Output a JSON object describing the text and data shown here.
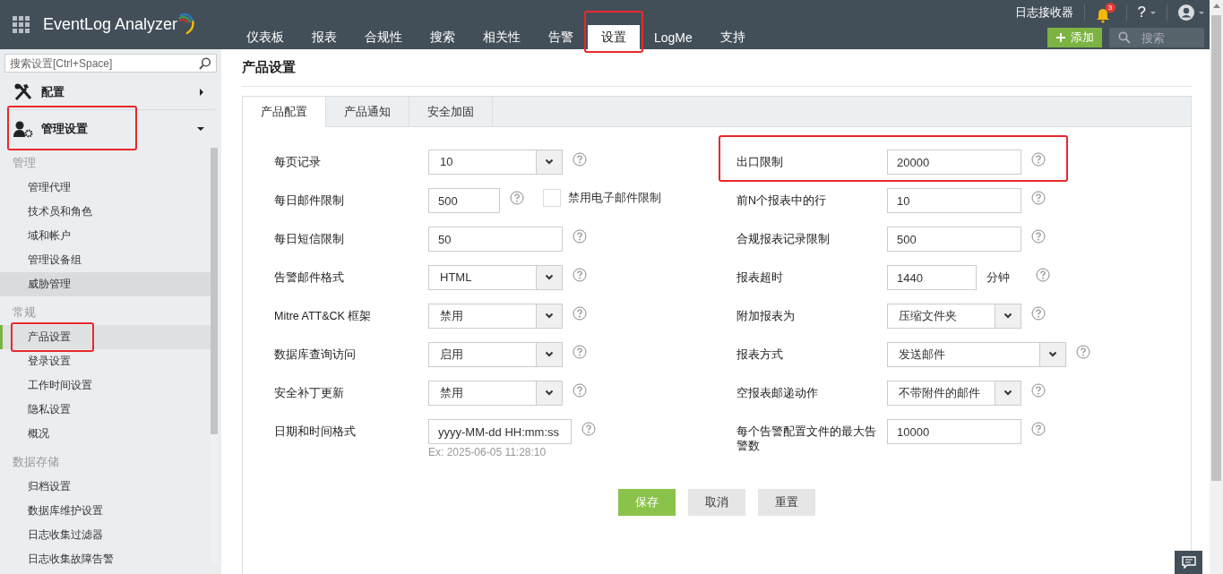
{
  "header": {
    "app_name": "EventLog Analyzer",
    "nav": [
      {
        "label": "仪表板",
        "selected": false,
        "highlighted": false
      },
      {
        "label": "报表",
        "selected": false,
        "highlighted": false
      },
      {
        "label": "合规性",
        "selected": false,
        "highlighted": false
      },
      {
        "label": "搜索",
        "selected": false,
        "highlighted": false
      },
      {
        "label": "相关性",
        "selected": false,
        "highlighted": false
      },
      {
        "label": "告警",
        "selected": false,
        "highlighted": false
      },
      {
        "label": "设置",
        "selected": true,
        "highlighted": true
      },
      {
        "label": "LogMe",
        "selected": false,
        "highlighted": false
      },
      {
        "label": "支持",
        "selected": false,
        "highlighted": false
      }
    ],
    "receiver_link": "日志接收器",
    "notification_count": "3",
    "help": "?",
    "add_button": "添加",
    "search": {
      "placeholder": "搜索"
    }
  },
  "sidebar": {
    "search": {
      "placeholder": "搜索设置[Ctrl+Space]"
    },
    "sections": [
      {
        "label": "配置",
        "expanded": false,
        "highlighted": false
      },
      {
        "label": "管理设置",
        "expanded": true,
        "highlighted": true
      }
    ],
    "groups": [
      {
        "title": "管理",
        "items": [
          {
            "label": "管理代理",
            "selected": false,
            "hovered": false,
            "highlighted": false
          },
          {
            "label": "技术员和角色",
            "selected": false,
            "hovered": false,
            "highlighted": false
          },
          {
            "label": "域和帐户",
            "selected": false,
            "hovered": false,
            "highlighted": false
          },
          {
            "label": "管理设备组",
            "selected": false,
            "hovered": false,
            "highlighted": false
          },
          {
            "label": "威胁管理",
            "selected": false,
            "hovered": true,
            "highlighted": false
          }
        ]
      },
      {
        "title": "常规",
        "items": [
          {
            "label": "产品设置",
            "selected": true,
            "hovered": false,
            "highlighted": true
          },
          {
            "label": "登录设置",
            "selected": false,
            "hovered": false,
            "highlighted": false
          },
          {
            "label": "工作时间设置",
            "selected": false,
            "hovered": false,
            "highlighted": false
          },
          {
            "label": "隐私设置",
            "selected": false,
            "hovered": false,
            "highlighted": false
          },
          {
            "label": "概况",
            "selected": false,
            "hovered": false,
            "highlighted": false
          }
        ]
      },
      {
        "title": "数据存储",
        "items": [
          {
            "label": "归档设置",
            "selected": false,
            "hovered": false,
            "highlighted": false
          },
          {
            "label": "数据库维护设置",
            "selected": false,
            "hovered": false,
            "highlighted": false
          },
          {
            "label": "日志收集过滤器",
            "selected": false,
            "hovered": false,
            "highlighted": false
          },
          {
            "label": "日志收集故障告警",
            "selected": false,
            "hovered": false,
            "highlighted": false
          }
        ]
      }
    ]
  },
  "page": {
    "title": "产品设置",
    "tabs": [
      {
        "label": "产品配置",
        "selected": true
      },
      {
        "label": "产品通知",
        "selected": false
      },
      {
        "label": "安全加固",
        "selected": false
      }
    ],
    "left_fields": [
      {
        "label": "每页记录",
        "kind": "select",
        "value": "10",
        "highlighted": false
      },
      {
        "label": "每日邮件限制",
        "kind": "short-input",
        "value": "500",
        "highlighted": false,
        "checkbox": {
          "label": "禁用电子邮件限制",
          "checked": false
        }
      },
      {
        "label": "每日短信限制",
        "kind": "input",
        "value": "50",
        "highlighted": false
      },
      {
        "label": "告警邮件格式",
        "kind": "select",
        "value": "HTML",
        "highlighted": false
      },
      {
        "label": "Mitre ATT&CK 框架",
        "kind": "select",
        "value": "禁用",
        "highlighted": false
      },
      {
        "label": "数据库查询访问",
        "kind": "select",
        "value": "启用",
        "highlighted": false
      },
      {
        "label": "安全补丁更新",
        "kind": "select",
        "value": "禁用",
        "highlighted": false
      },
      {
        "label": "日期和时间格式",
        "kind": "date-input",
        "value": "yyyy-MM-dd HH:mm:ss",
        "hint": "Ex: 2025-06-05 11:28:10",
        "highlighted": false
      }
    ],
    "right_fields": [
      {
        "label": "出口限制",
        "kind": "input",
        "value": "20000",
        "highlighted": true
      },
      {
        "label": "前N个报表中的行",
        "kind": "input",
        "value": "10",
        "highlighted": false
      },
      {
        "label": "合规报表记录限制",
        "kind": "input",
        "value": "500",
        "highlighted": false
      },
      {
        "label": "报表超时",
        "kind": "unit-input",
        "value": "1440",
        "unit": "分钟",
        "highlighted": false
      },
      {
        "label": "附加报表为",
        "kind": "select",
        "value": "压缩文件夹",
        "highlighted": false
      },
      {
        "label": "报表方式",
        "kind": "wide-select",
        "value": "发送邮件",
        "highlighted": false
      },
      {
        "label": "空报表邮递动作",
        "kind": "select",
        "value": "不带附件的邮件",
        "highlighted": false
      },
      {
        "label": "每个告警配置文件的最大告警数",
        "kind": "input",
        "value": "10000",
        "highlighted": false
      }
    ],
    "buttons": [
      {
        "label": "保存",
        "kind": "primary"
      },
      {
        "label": "取消",
        "kind": "secondary"
      },
      {
        "label": "重置",
        "kind": "secondary"
      }
    ]
  }
}
